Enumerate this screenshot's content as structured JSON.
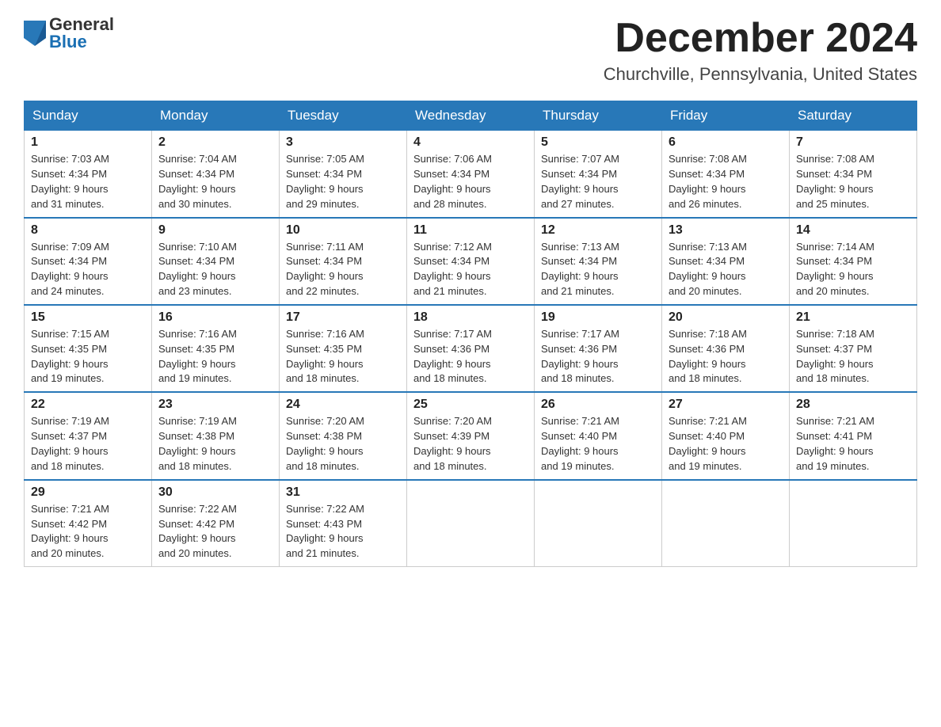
{
  "header": {
    "logo_general": "General",
    "logo_blue": "Blue",
    "month_title": "December 2024",
    "location": "Churchville, Pennsylvania, United States"
  },
  "weekdays": [
    "Sunday",
    "Monday",
    "Tuesday",
    "Wednesday",
    "Thursday",
    "Friday",
    "Saturday"
  ],
  "weeks": [
    [
      {
        "day": "1",
        "sunrise": "7:03 AM",
        "sunset": "4:34 PM",
        "daylight": "9 hours and 31 minutes."
      },
      {
        "day": "2",
        "sunrise": "7:04 AM",
        "sunset": "4:34 PM",
        "daylight": "9 hours and 30 minutes."
      },
      {
        "day": "3",
        "sunrise": "7:05 AM",
        "sunset": "4:34 PM",
        "daylight": "9 hours and 29 minutes."
      },
      {
        "day": "4",
        "sunrise": "7:06 AM",
        "sunset": "4:34 PM",
        "daylight": "9 hours and 28 minutes."
      },
      {
        "day": "5",
        "sunrise": "7:07 AM",
        "sunset": "4:34 PM",
        "daylight": "9 hours and 27 minutes."
      },
      {
        "day": "6",
        "sunrise": "7:08 AM",
        "sunset": "4:34 PM",
        "daylight": "9 hours and 26 minutes."
      },
      {
        "day": "7",
        "sunrise": "7:08 AM",
        "sunset": "4:34 PM",
        "daylight": "9 hours and 25 minutes."
      }
    ],
    [
      {
        "day": "8",
        "sunrise": "7:09 AM",
        "sunset": "4:34 PM",
        "daylight": "9 hours and 24 minutes."
      },
      {
        "day": "9",
        "sunrise": "7:10 AM",
        "sunset": "4:34 PM",
        "daylight": "9 hours and 23 minutes."
      },
      {
        "day": "10",
        "sunrise": "7:11 AM",
        "sunset": "4:34 PM",
        "daylight": "9 hours and 22 minutes."
      },
      {
        "day": "11",
        "sunrise": "7:12 AM",
        "sunset": "4:34 PM",
        "daylight": "9 hours and 21 minutes."
      },
      {
        "day": "12",
        "sunrise": "7:13 AM",
        "sunset": "4:34 PM",
        "daylight": "9 hours and 21 minutes."
      },
      {
        "day": "13",
        "sunrise": "7:13 AM",
        "sunset": "4:34 PM",
        "daylight": "9 hours and 20 minutes."
      },
      {
        "day": "14",
        "sunrise": "7:14 AM",
        "sunset": "4:34 PM",
        "daylight": "9 hours and 20 minutes."
      }
    ],
    [
      {
        "day": "15",
        "sunrise": "7:15 AM",
        "sunset": "4:35 PM",
        "daylight": "9 hours and 19 minutes."
      },
      {
        "day": "16",
        "sunrise": "7:16 AM",
        "sunset": "4:35 PM",
        "daylight": "9 hours and 19 minutes."
      },
      {
        "day": "17",
        "sunrise": "7:16 AM",
        "sunset": "4:35 PM",
        "daylight": "9 hours and 18 minutes."
      },
      {
        "day": "18",
        "sunrise": "7:17 AM",
        "sunset": "4:36 PM",
        "daylight": "9 hours and 18 minutes."
      },
      {
        "day": "19",
        "sunrise": "7:17 AM",
        "sunset": "4:36 PM",
        "daylight": "9 hours and 18 minutes."
      },
      {
        "day": "20",
        "sunrise": "7:18 AM",
        "sunset": "4:36 PM",
        "daylight": "9 hours and 18 minutes."
      },
      {
        "day": "21",
        "sunrise": "7:18 AM",
        "sunset": "4:37 PM",
        "daylight": "9 hours and 18 minutes."
      }
    ],
    [
      {
        "day": "22",
        "sunrise": "7:19 AM",
        "sunset": "4:37 PM",
        "daylight": "9 hours and 18 minutes."
      },
      {
        "day": "23",
        "sunrise": "7:19 AM",
        "sunset": "4:38 PM",
        "daylight": "9 hours and 18 minutes."
      },
      {
        "day": "24",
        "sunrise": "7:20 AM",
        "sunset": "4:38 PM",
        "daylight": "9 hours and 18 minutes."
      },
      {
        "day": "25",
        "sunrise": "7:20 AM",
        "sunset": "4:39 PM",
        "daylight": "9 hours and 18 minutes."
      },
      {
        "day": "26",
        "sunrise": "7:21 AM",
        "sunset": "4:40 PM",
        "daylight": "9 hours and 19 minutes."
      },
      {
        "day": "27",
        "sunrise": "7:21 AM",
        "sunset": "4:40 PM",
        "daylight": "9 hours and 19 minutes."
      },
      {
        "day": "28",
        "sunrise": "7:21 AM",
        "sunset": "4:41 PM",
        "daylight": "9 hours and 19 minutes."
      }
    ],
    [
      {
        "day": "29",
        "sunrise": "7:21 AM",
        "sunset": "4:42 PM",
        "daylight": "9 hours and 20 minutes."
      },
      {
        "day": "30",
        "sunrise": "7:22 AM",
        "sunset": "4:42 PM",
        "daylight": "9 hours and 20 minutes."
      },
      {
        "day": "31",
        "sunrise": "7:22 AM",
        "sunset": "4:43 PM",
        "daylight": "9 hours and 21 minutes."
      },
      null,
      null,
      null,
      null
    ]
  ],
  "labels": {
    "sunrise_prefix": "Sunrise: ",
    "sunset_prefix": "Sunset: ",
    "daylight_prefix": "Daylight: "
  }
}
